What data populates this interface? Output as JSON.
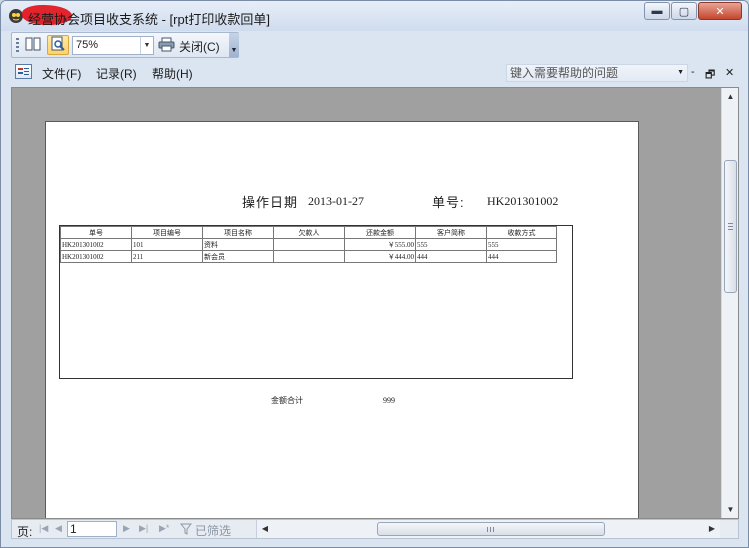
{
  "window": {
    "title": "   经营协会项目收支系统 - [rpt打印收款回单]",
    "min_label": "▬",
    "max_label": "▢",
    "close_label": "✕"
  },
  "toolbar": {
    "zoom_value": "75%",
    "close_label": "关闭(C)",
    "icons": [
      "single-page-icon",
      "zoom-icon",
      "printer-icon"
    ]
  },
  "menu": {
    "items": [
      "文件(F)",
      "记录(R)",
      "帮助(H)"
    ],
    "help_placeholder": "键入需要帮助的问题",
    "mdi_min": "-",
    "mdi_restore": "🗗",
    "mdi_close": "✕"
  },
  "report": {
    "op_date_label": "操作日期",
    "op_date_value": "2013-01-27",
    "no_label": "单号:",
    "no_value": "HK201301002",
    "columns": [
      "单号",
      "项目编号",
      "项目名称",
      "欠款人",
      "还款金额",
      "客户简称",
      "收款方式"
    ],
    "rows": [
      [
        "HK201301002",
        "101",
        "资料",
        "",
        "￥555.00",
        "555",
        "555"
      ],
      [
        "HK201301002",
        "211",
        "新会员",
        "",
        "￥444.00",
        "444",
        "444"
      ]
    ],
    "total_label": "金额合计",
    "total_value": "999"
  },
  "navigation": {
    "page_label": "页:",
    "page_value": "1",
    "filter_label": "已筛选"
  },
  "colors": {
    "window_bg": "#dbe5f1",
    "client_bg": "#a0a0a0",
    "active_button": "#ffd16a"
  }
}
